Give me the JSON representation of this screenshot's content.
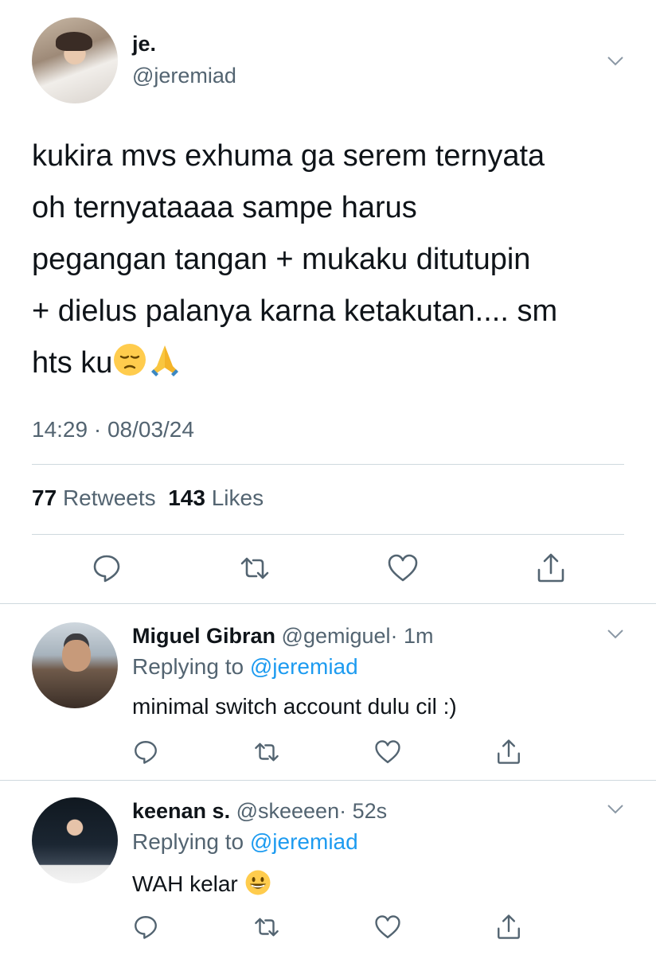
{
  "tweet": {
    "author_name": "je.",
    "author_handle": "@jeremiad",
    "text": "kukira mvs exhuma ga serem ternyata\noh ternyataaaa sampe harus\npegangan tangan + mukaku ditutupin\n+ dielus palanya karna ketakutan.... sm\nhts ku",
    "emojis": [
      "pensive-face",
      "folded-hands"
    ],
    "timestamp": "14:29 · 08/03/24",
    "retweets_count": "77",
    "retweets_label": "Retweets",
    "likes_count": "143",
    "likes_label": "Likes"
  },
  "replies": [
    {
      "name": "Miguel Gibran",
      "handle": "@gemiguel",
      "time": "· 1m",
      "replying_prefix": "Replying to",
      "replying_to": "@jeremiad",
      "text": "minimal switch account dulu cil :)"
    },
    {
      "name": "keenan s.",
      "handle": "@skeeeen",
      "time": "· 52s",
      "replying_prefix": "Replying to",
      "replying_to": "@jeremiad",
      "text": "WAH kelar",
      "emoji": "grinning-face"
    }
  ],
  "colors": {
    "text": "#0f1419",
    "secondary": "#536471",
    "link": "#1d9bf0",
    "divider": "#cfd9de"
  }
}
